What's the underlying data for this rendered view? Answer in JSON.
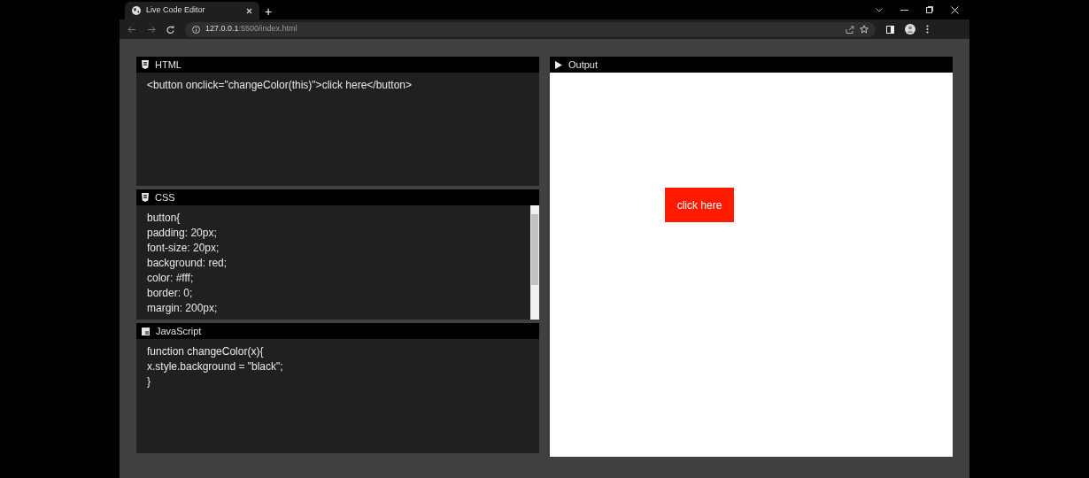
{
  "browser": {
    "tab_title": "Live Code Editor",
    "new_tab": "+",
    "url_host": "127.0.0.1",
    "url_rest": ":5500/index.html"
  },
  "editors": [
    {
      "kind": "html",
      "title": "HTML",
      "scrollbar": false,
      "lines": [
        "<button onclick=\"changeColor(this)\">click here</button>"
      ]
    },
    {
      "kind": "css",
      "title": "CSS",
      "scrollbar": true,
      "lines": [
        "button{",
        "padding: 20px;",
        "font-size: 20px;",
        "background: red;",
        "color: #fff;",
        "border: 0;",
        "margin: 200px;"
      ]
    },
    {
      "kind": "js",
      "title": "JavaScript",
      "scrollbar": false,
      "lines": [
        "function changeColor(x){",
        "x.style.background = \"black\";",
        "}"
      ]
    }
  ],
  "output": {
    "title": "Output",
    "button_label": "click here"
  }
}
